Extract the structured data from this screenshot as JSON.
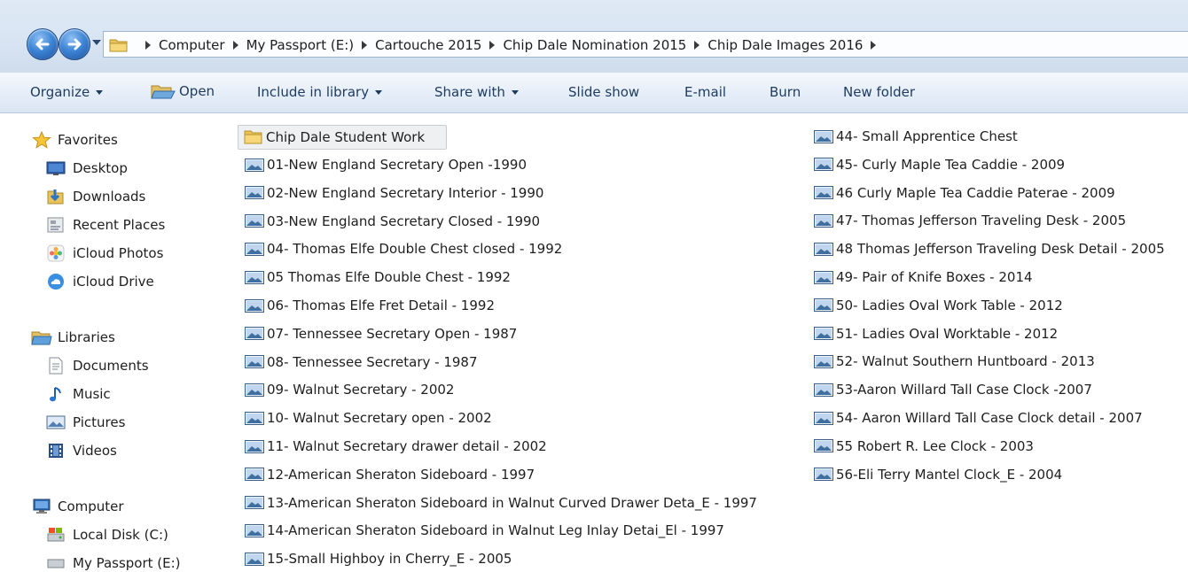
{
  "address": {
    "breadcrumbs": [
      "Computer",
      "My Passport (E:)",
      "Cartouche 2015",
      "Chip Dale Nomination 2015",
      "Chip Dale Images 2016"
    ]
  },
  "toolbar": {
    "organize": "Organize",
    "open": "Open",
    "include": "Include in library",
    "share": "Share with",
    "slideshow": "Slide show",
    "email": "E-mail",
    "burn": "Burn",
    "newfolder": "New folder"
  },
  "nav": {
    "favorites": "Favorites",
    "desktop": "Desktop",
    "downloads": "Downloads",
    "recent": "Recent Places",
    "icloud_photos": "iCloud Photos",
    "icloud_drive": "iCloud Drive",
    "libraries": "Libraries",
    "documents": "Documents",
    "music": "Music",
    "pictures": "Pictures",
    "videos": "Videos",
    "computer": "Computer",
    "local_disk": "Local Disk (C:)",
    "passport": "My Passport (E:)"
  },
  "files": {
    "folder": "Chip Dale Student Work",
    "col1": [
      "01-New England Secretary Open -1990",
      "02-New England Secretary Interior - 1990",
      "03-New England Secretary Closed - 1990",
      "04- Thomas Elfe Double Chest closed  - 1992",
      "05 Thomas Elfe Double Chest - 1992",
      "06- Thomas Elfe Fret Detail - 1992",
      "07- Tennessee Secretary Open  -  1987",
      "08- Tennessee Secretary - 1987",
      "09- Walnut Secretary - 2002",
      "10- Walnut Secretary open - 2002",
      "11- Walnut Secretary drawer detail - 2002",
      "12-American Sheraton Sideboard - 1997",
      "13-American Sheraton Sideboard  in Walnut Curved Drawer Deta_E - 1997",
      "14-American Sheraton Sideboard  in Walnut Leg Inlay Detai_El - 1997",
      "15-Small Highboy in Cherry_E  -  2005"
    ],
    "col2": [
      "44- Small Apprentice Chest",
      "45- Curly Maple Tea Caddie - 2009",
      "46 Curly Maple Tea Caddie Paterae - 2009",
      "47- Thomas Jefferson Traveling Desk  - 2005",
      "48 Thomas Jefferson Traveling Desk Detail - 2005",
      "49- Pair of Knife Boxes - 2014",
      "50- Ladies Oval Work Table - 2012",
      "51- Ladies Oval Worktable - 2012",
      "52- Walnut Southern Huntboard - 2013",
      "53-Aaron Willard Tall Case Clock  -2007",
      "54- Aaron Willard Tall Case Clock detail - 2007",
      "55 Robert R. Lee Clock - 2003",
      "56-Eli Terry Mantel Clock_E - 2004"
    ]
  }
}
